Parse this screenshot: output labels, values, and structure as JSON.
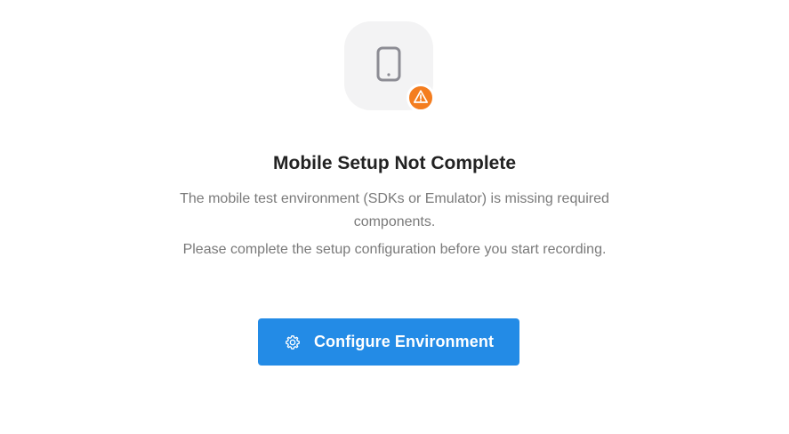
{
  "setup_notice": {
    "title": "Mobile Setup Not Complete",
    "description_line1": "The mobile test environment (SDKs or Emulator) is missing required components.",
    "description_line2": "Please complete the setup configuration before you start recording.",
    "icons": {
      "main": "mobile-phone-icon",
      "badge": "warning-triangle-icon",
      "button": "gear-icon"
    },
    "colors": {
      "icon_background": "#f3f3f4",
      "phone_icon": "#8c8c94",
      "warning_badge": "#f47d1f",
      "primary_button": "#238be6",
      "title_text": "#222222",
      "body_text": "#7a7a7a"
    }
  },
  "actions": {
    "configure_label": "Configure Environment"
  }
}
